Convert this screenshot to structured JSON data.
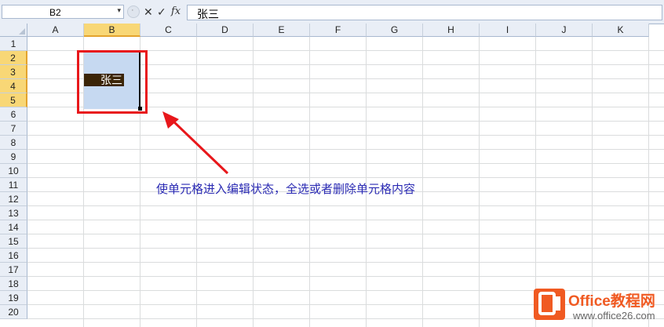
{
  "formula_bar": {
    "name_box_value": "B2",
    "name_box_arrow": "▾",
    "cancel_glyph": "✕",
    "enter_glyph": "✓",
    "fx_label": "fx",
    "formula_value": "张三"
  },
  "columns": [
    "A",
    "B",
    "C",
    "D",
    "E",
    "F",
    "G",
    "H",
    "I",
    "J",
    "K"
  ],
  "rows": [
    "1",
    "2",
    "3",
    "4",
    "5",
    "6",
    "7",
    "8",
    "9",
    "10",
    "11",
    "12",
    "13",
    "14",
    "15",
    "16",
    "17",
    "18",
    "19",
    "20"
  ],
  "active_column": "B",
  "active_rows": [
    "2",
    "3",
    "4",
    "5"
  ],
  "cell_editor": {
    "text": "张三"
  },
  "annotation": {
    "text": "使单元格进入编辑状态，全选或者删除单元格内容"
  },
  "watermark": {
    "brand": "Office教程网",
    "url": "www.office26.com"
  },
  "colors": {
    "highlight": "#e8171b",
    "annotation": "#2a2ab3",
    "selection": "#c6d9f1",
    "header_active": "#f8d776",
    "brand": "#f05a22"
  }
}
